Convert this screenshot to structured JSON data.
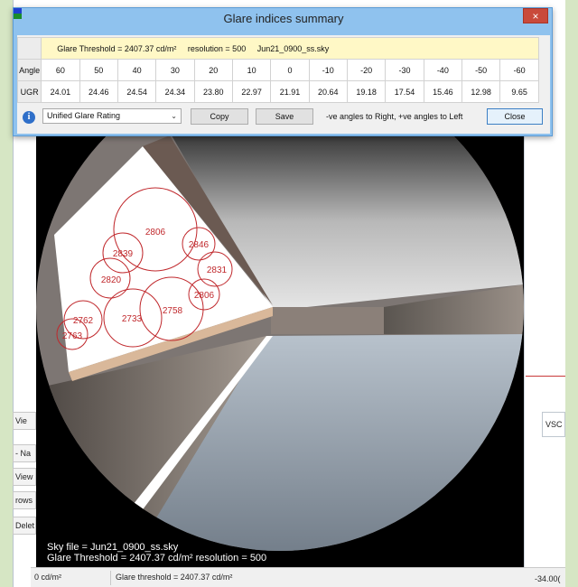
{
  "dialog": {
    "title": "Glare indices summary",
    "close_glyph": "×",
    "info_bar": {
      "threshold": "Glare Threshold = 2407.37 cd/m²",
      "resolution": "resolution = 500",
      "sky": "Jun21_0900_ss.sky"
    },
    "table": {
      "row_labels": [
        "Angle",
        "UGR"
      ],
      "angles": [
        "60",
        "50",
        "40",
        "30",
        "20",
        "10",
        "0",
        "-10",
        "-20",
        "-30",
        "-40",
        "-50",
        "-60"
      ],
      "ugr": [
        "24.01",
        "24.46",
        "24.54",
        "24.34",
        "23.80",
        "22.97",
        "21.91",
        "20.64",
        "19.18",
        "17.54",
        "15.46",
        "12.98",
        "9.65"
      ]
    },
    "selected_index": "Unified Glare Rating",
    "copy_label": "Copy",
    "save_label": "Save",
    "hint": "-ve angles to Right, +ve angles to Left",
    "close_label": "Close"
  },
  "render": {
    "glare_sources": [
      "2806",
      "2846",
      "2839",
      "2831",
      "2820",
      "2806",
      "2758",
      "2733",
      "2762",
      "2763"
    ],
    "caption_sky": "Sky file = Jun21_0900_ss.sky",
    "caption_threshold": "Glare Threshold = 2407.37 cd/m²  resolution = 500"
  },
  "status": {
    "left": "0 cd/m²",
    "middle": "Glare threshold = 2407.37 cd/m²",
    "right": "-34.00("
  },
  "background": {
    "side_items": [
      "Vie",
      "- Na",
      "View",
      "rows",
      "Delet"
    ],
    "right_cell": "VSC"
  },
  "colors": {
    "title_bar": "#8fc2ee",
    "info_bar": "#fff8c6",
    "glare_circle": "#c0282c",
    "close_button": "#c94a3b"
  }
}
